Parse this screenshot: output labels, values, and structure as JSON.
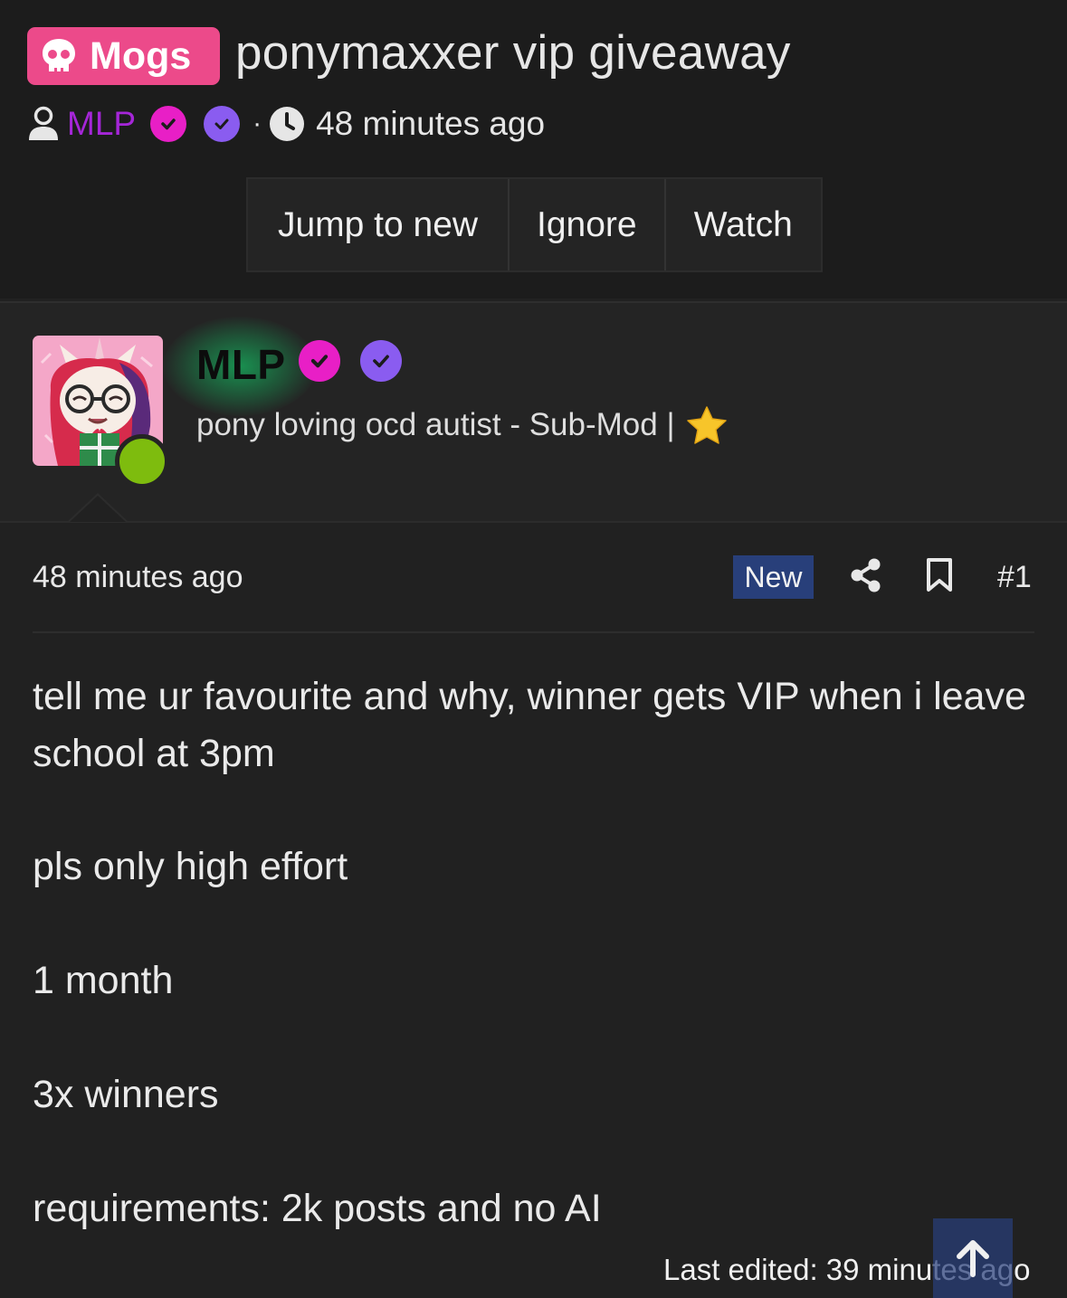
{
  "thread": {
    "prefix": "Mogs",
    "title": "ponymaxxer vip giveaway",
    "author": "MLP",
    "meta_separator": "·",
    "time": "48 minutes ago"
  },
  "actions": {
    "jump_label": "Jump to new",
    "ignore_label": "Ignore",
    "watch_label": "Watch"
  },
  "user": {
    "name": "MLP",
    "title": "pony loving ocd autist - Sub-Mod |",
    "online": true
  },
  "post": {
    "time": "48 minutes ago",
    "new_label": "New",
    "number": "#1",
    "paragraphs": [
      "tell me ur favourite and why, winner gets VIP when i leave school at 3pm",
      "pls only high effort",
      "1 month",
      "3x winners",
      "requirements: 2k posts and no AI"
    ],
    "last_edited": "Last edited: 39 minutes ago"
  },
  "colors": {
    "prefix_bg": "#ec4a8a",
    "author_link": "#a526d8",
    "badge_pink": "#e81fc6",
    "badge_purple": "#8a5cf0",
    "online": "#7ebc0e",
    "new_badge_bg": "#283f7a",
    "username_glow": "#16b45f"
  },
  "icons": {
    "prefix": "skull-icon",
    "author": "user-icon",
    "time": "clock-icon",
    "share": "share-icon",
    "bookmark": "bookmark-icon",
    "scroll": "arrow-up-icon",
    "title_emoji": "star-icon"
  }
}
